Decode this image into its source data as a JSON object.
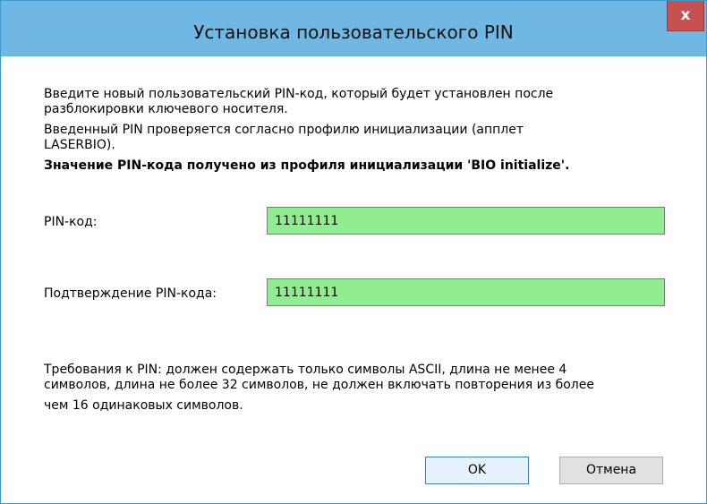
{
  "window": {
    "title": "Установка пользовательского PIN",
    "close_label": "x"
  },
  "info": {
    "line1": "Введите новый пользовательский PIN-код, который будет установлен после",
    "line2": "разблокировки ключевого носителя.",
    "line3": "Введенный PIN проверяется согласно профилю инициализации (апплет",
    "line4": "LASERBIO).",
    "bold_line": "Значение PIN-кода получено из профиля инициализации 'BIO initialize'."
  },
  "pin": {
    "label": "PIN-код:",
    "value": "11111111"
  },
  "confirm": {
    "label": "Подтверждение PIN-кода:",
    "value": "11111111"
  },
  "requirements": {
    "line1": "Требования к PIN: должен содержать только символы ASCII, длина не менее 4",
    "line2": "символов, длина не более 32 символов, не должен включать повторения из более",
    "line3": "чем 16 одинаковых символов."
  },
  "buttons": {
    "ok": "OK",
    "cancel": "Отмена"
  },
  "colors": {
    "titlebar": "#6fb8e3",
    "close": "#c75050",
    "input_valid": "#90ee90"
  }
}
